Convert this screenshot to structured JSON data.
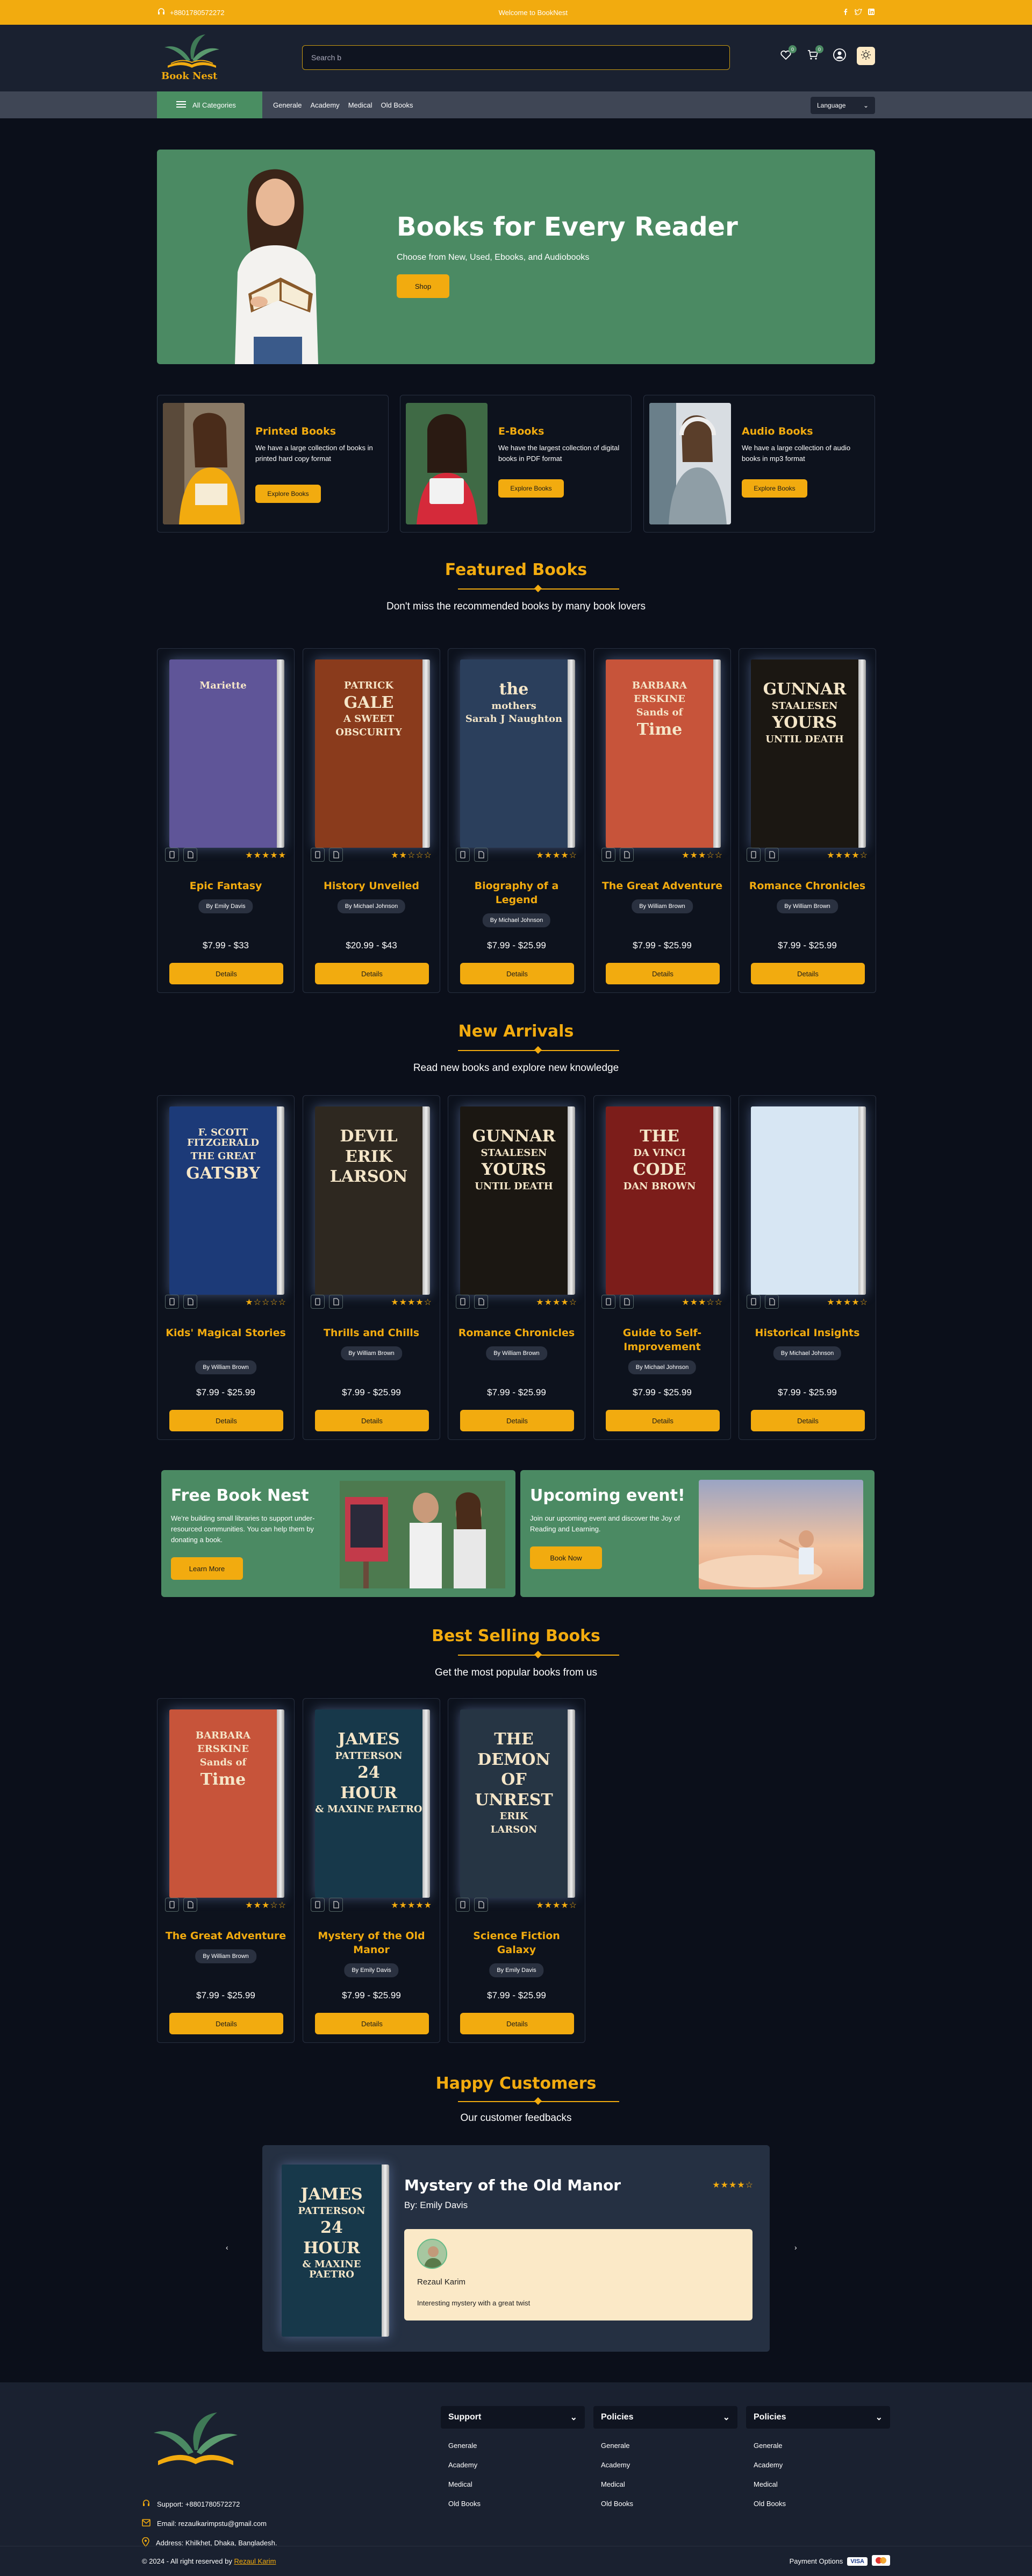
{
  "topbar": {
    "phone": "+8801780572272",
    "welcome": "Welcome to BookNest"
  },
  "brand": {
    "name": "Book Nest",
    "bg": "#0b0f1a",
    "accent": "#f2ab0f",
    "green": "#4b8a63"
  },
  "header": {
    "search_placeholder": "Search b",
    "wishlist_count": "0",
    "cart_count": "0"
  },
  "nav": {
    "all_categories": "All Categories",
    "links": [
      "Generale",
      "Academy",
      "Medical",
      "Old Books"
    ],
    "language": "Language"
  },
  "hero": {
    "title": "Books for Every Reader",
    "subtitle": "Choose from New, Used, Ebooks, and Audiobooks",
    "button": "Shop"
  },
  "categories": [
    {
      "title": "Printed Books",
      "text": "We have a large collection of books in printed hard copy format",
      "button": "Explore Books"
    },
    {
      "title": "E-Books",
      "text": "We have the largest collection of digital books in PDF format",
      "button": "Explore Books"
    },
    {
      "title": "Audio Books",
      "text": "We have a large collection of audio books in mp3 format",
      "button": "Explore Books"
    }
  ],
  "featured": {
    "title": "Featured Books",
    "subtitle": "Don't miss the recommended books by many book lovers",
    "books": [
      {
        "title": "Epic Fantasy",
        "author": "By Emily Davis",
        "price": "$7.99 - $33",
        "rating": 5,
        "button": "Details",
        "cover_lines": [
          "Mariette"
        ],
        "cover_bg": "#5f5598"
      },
      {
        "title": "History Unveiled",
        "author": "By Michael Johnson",
        "price": "$20.99 - $43",
        "rating": 2,
        "button": "Details",
        "cover_lines": [
          "PATRICK",
          "GALE",
          "A SWEET",
          "OBSCURITY"
        ],
        "cover_bg": "#8a3b1c"
      },
      {
        "title": "Biography of a Legend",
        "author": "By Michael Johnson",
        "price": "$7.99 - $25.99",
        "rating": 4,
        "button": "Details",
        "cover_lines": [
          "the",
          "mothers",
          "Sarah J Naughton"
        ],
        "cover_bg": "#2b3f5c"
      },
      {
        "title": "The Great Adventure",
        "author": "By William Brown",
        "price": "$7.99 - $25.99",
        "rating": 3,
        "button": "Details",
        "cover_lines": [
          "BARBARA",
          "ERSKINE",
          "Sands of",
          "Time"
        ],
        "cover_bg": "#c7543a"
      },
      {
        "title": "Romance Chronicles",
        "author": "By William Brown",
        "price": "$7.99 - $25.99",
        "rating": 4,
        "button": "Details",
        "cover_lines": [
          "GUNNAR",
          "STAALESEN",
          "YOURS",
          "UNTIL DEATH"
        ],
        "cover_bg": "#1b1712"
      }
    ]
  },
  "arrivals": {
    "title": "New Arrivals",
    "subtitle": "Read new books and explore new knowledge",
    "books": [
      {
        "title": "Kids' Magical Stories",
        "author": "By William Brown",
        "price": "$7.99 - $25.99",
        "rating": 1,
        "button": "Details",
        "cover_lines": [
          "F. SCOTT FITZGERALD",
          "THE GREAT",
          "GATSBY"
        ],
        "cover_bg": "#1c3a78"
      },
      {
        "title": "Thrills and Chills",
        "author": "By William Brown",
        "price": "$7.99 - $25.99",
        "rating": 4,
        "button": "Details",
        "cover_lines": [
          "DEVIL",
          "ERIK",
          "LARSON"
        ],
        "cover_bg": "#2e2820"
      },
      {
        "title": "Romance Chronicles",
        "author": "By William Brown",
        "price": "$7.99 - $25.99",
        "rating": 4,
        "button": "Details",
        "cover_lines": [
          "GUNNAR",
          "STAALESEN",
          "YOURS",
          "UNTIL DEATH"
        ],
        "cover_bg": "#1b1712"
      },
      {
        "title": "Guide to Self-Improvement",
        "author": "By Michael Johnson",
        "price": "$7.99 - $25.99",
        "rating": 3,
        "button": "Details",
        "cover_lines": [
          "THE",
          "DA VINCI",
          "CODE",
          "DAN BROWN"
        ],
        "cover_bg": "#7c1d1a"
      },
      {
        "title": "Historical Insights",
        "author": "By Michael Johnson",
        "price": "$7.99 - $25.99",
        "rating": 4,
        "button": "Details",
        "cover_lines": [
          ""
        ],
        "cover_bg": "#d7e6f3"
      }
    ]
  },
  "promos": [
    {
      "title": "Free Book Nest",
      "text": "We're building small libraries to support under-resourced communities. You can help them by donating a book.",
      "button": "Learn More"
    },
    {
      "title": "Upcoming event!",
      "text": "Join our upcoming event and discover the Joy of Reading and Learning.",
      "button": "Book Now"
    }
  ],
  "bestselling": {
    "title": "Best Selling Books",
    "subtitle": "Get the most popular books from us",
    "books": [
      {
        "title": "The Great Adventure",
        "author": "By William Brown",
        "price": "$7.99 - $25.99",
        "rating": 3,
        "button": "Details",
        "cover_lines": [
          "BARBARA",
          "ERSKINE",
          "Sands of",
          "Time"
        ],
        "cover_bg": "#c7543a"
      },
      {
        "title": "Mystery of the Old Manor",
        "author": "By Emily Davis",
        "price": "$7.99 - $25.99",
        "rating": 5,
        "button": "Details",
        "cover_lines": [
          "JAMES",
          "PATTERSON",
          "24",
          "HOUR",
          "& MAXINE PAETRO"
        ],
        "cover_bg": "#17384a"
      },
      {
        "title": "Science Fiction Galaxy",
        "author": "By Emily Davis",
        "price": "$7.99 - $25.99",
        "rating": 4,
        "button": "Details",
        "cover_lines": [
          "THE",
          "DEMON",
          "OF",
          "UNREST",
          "ERIK",
          "LARSON"
        ],
        "cover_bg": "#263544"
      }
    ]
  },
  "customers": {
    "title": "Happy Customers",
    "subtitle": "Our customer feedbacks",
    "review": {
      "book": "Mystery of the Old Manor",
      "author": "By: Emily Davis",
      "rating": 4,
      "name": "Rezaul Karim",
      "text": "Interesting mystery with a great twist",
      "cover_lines": [
        "JAMES",
        "PATTERSON",
        "24",
        "HOUR",
        "& MAXINE PAETRO"
      ]
    }
  },
  "footer": {
    "support": "Support: +8801780572272",
    "email": "Email: rezaulkarimpstu@gmail.com",
    "address": "Address: Khilkhet, Dhaka, Bangladesh.",
    "columns": [
      {
        "title": "Support",
        "links": [
          "Generale",
          "Academy",
          "Medical",
          "Old Books"
        ]
      },
      {
        "title": "Policies",
        "links": [
          "Generale",
          "Academy",
          "Medical",
          "Old Books"
        ]
      },
      {
        "title": "Policies",
        "links": [
          "Generale",
          "Academy",
          "Medical",
          "Old Books"
        ]
      }
    ],
    "copyright": "© 2024 - All right reserved by",
    "copyright_link": "Rezaul Karim",
    "payment_label": "Payment Options",
    "payment_visa": "VISA"
  }
}
